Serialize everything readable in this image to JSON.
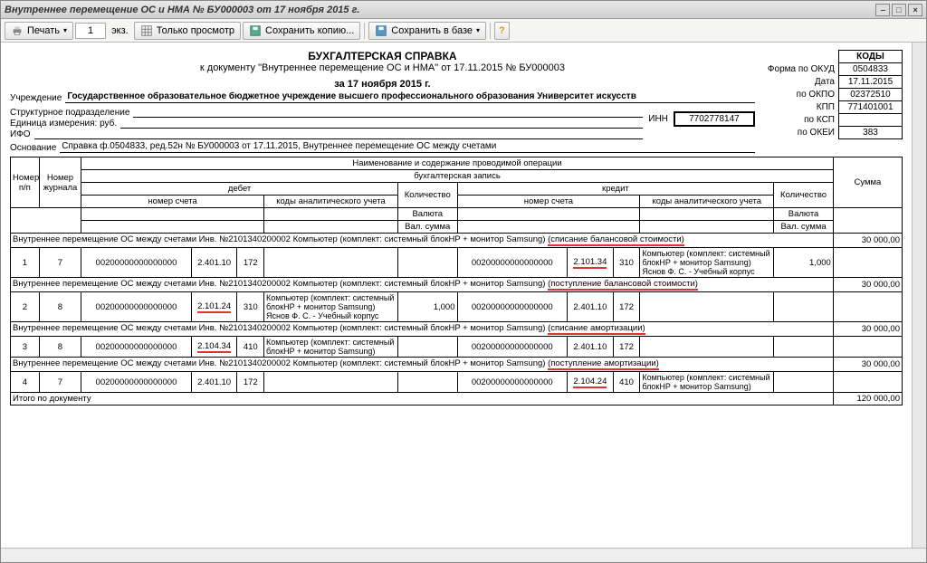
{
  "window": {
    "title": "Внутреннее перемещение ОС и НМА № БУ000003 от 17 ноября 2015 г."
  },
  "toolbar": {
    "print": "Печать",
    "copies": "1",
    "copies_unit": "экз.",
    "viewonly": "Только просмотр",
    "savecopy": "Сохранить копию...",
    "savedb": "Сохранить в базе"
  },
  "doc": {
    "title": "БУХГАЛТЕРСКАЯ СПРАВКА",
    "subtitle": "к документу \"Внутреннее перемещение ОС и НМА\" от 17.11.2015 № БУ000003",
    "date_line": "за 17 ноября 2015 г.",
    "org_label": "Учреждение",
    "org": "Государственное образовательное бюджетное учреждение высшего профессионального образования  Университет искусств",
    "subdiv_label": "Структурное подразделение",
    "unit_label": "Единица измерения: руб.",
    "ifo_label": "ИФО",
    "basis_label": "Основание",
    "basis": "Справка ф.0504833, ред.52н № БУ000003 от 17.11.2015, Внутреннее перемещение ОС между счетами",
    "inn_label": "ИНН",
    "inn": "7702778147"
  },
  "codes": {
    "head": "КОДЫ",
    "okud_lbl": "Форма по ОКУД",
    "okud": "0504833",
    "date_lbl": "Дата",
    "date": "17.11.2015",
    "okpo_lbl": "по ОКПО",
    "okpo": "02372510",
    "kpp_lbl": "КПП",
    "kpp": "771401001",
    "ksp_lbl": "по КСП",
    "ksp": "",
    "okei_lbl": "по ОКЕИ",
    "okei": "383"
  },
  "th": {
    "op": "Наименование и содержание проводимой операции",
    "entry": "бухгалтерская запись",
    "npp": "Номер п/п",
    "jour": "Номер журнала",
    "debit": "дебет",
    "credit": "кредит",
    "acc": "номер счета",
    "anal": "коды аналитического учета",
    "qty": "Количество",
    "cur": "Валюта",
    "valsum": "Вал. сумма",
    "sum": "Сумма"
  },
  "groups": [
    {
      "title_a": "Внутреннее перемещение ОС между счетами Инв. №2101340200002 Компьютер (комплект: системный блокHP + монитор Samsung)",
      "title_b": "(списание балансовой стоимости)",
      "sum": "30 000,00",
      "row": {
        "n": "1",
        "j": "7",
        "d_acc": "00200000000000000",
        "d_code": "2.401.10",
        "d_sub": "172",
        "d_anal": "",
        "c_acc": "00200000000000000",
        "c_code": "2.101.34",
        "c_sub": "310",
        "c_anal1": "Компьютер (комплект: системный блокHP + монитор Samsung)",
        "c_anal2": "Яснов Ф. С. - Учебный корпус",
        "qty": "1,000",
        "red": "c"
      }
    },
    {
      "title_a": "Внутреннее перемещение ОС между счетами Инв. №2101340200002 Компьютер (комплект: системный блокHP + монитор Samsung)",
      "title_b": "(поступление балансовой стоимости)",
      "sum": "30 000,00",
      "row": {
        "n": "2",
        "j": "8",
        "d_acc": "00200000000000000",
        "d_code": "2.101.24",
        "d_sub": "310",
        "d_anal1": "Компьютер (комплект: системный блокHP + монитор Samsung)",
        "d_anal2": "Яснов Ф. С. - Учебный корпус",
        "c_acc": "00200000000000000",
        "c_code": "2.401.10",
        "c_sub": "172",
        "c_anal": "",
        "qty": "1,000",
        "red": "d"
      }
    },
    {
      "title_a": "Внутреннее перемещение ОС между счетами Инв. №2101340200002 Компьютер (комплект: системный блокHP + монитор Samsung)",
      "title_b": "(списание амортизации)",
      "sum": "30 000,00",
      "row": {
        "n": "3",
        "j": "8",
        "d_acc": "00200000000000000",
        "d_code": "2.104.34",
        "d_sub": "410",
        "d_anal1": "Компьютер (комплект: системный блокHP + монитор Samsung)",
        "c_acc": "00200000000000000",
        "c_code": "2.401.10",
        "c_sub": "172",
        "c_anal": "",
        "qty": "",
        "red": "d"
      }
    },
    {
      "title_a": "Внутреннее перемещение ОС между счетами Инв. №2101340200002 Компьютер (комплект: системный блокHP + монитор Samsung)",
      "title_b": "(поступление амортизации)",
      "sum": "30 000,00",
      "row": {
        "n": "4",
        "j": "7",
        "d_acc": "00200000000000000",
        "d_code": "2.401.10",
        "d_sub": "172",
        "d_anal": "",
        "c_acc": "00200000000000000",
        "c_code": "2.104.24",
        "c_sub": "410",
        "c_anal1": "Компьютер (комплект: системный блокHP + монитор Samsung)",
        "qty": "",
        "red": "c"
      }
    }
  ],
  "total": {
    "label": "Итого по документу",
    "sum": "120 000,00"
  }
}
